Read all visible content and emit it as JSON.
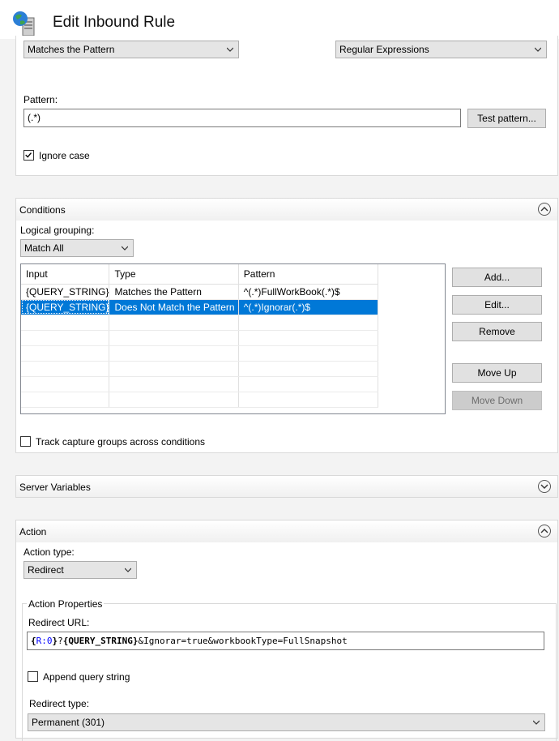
{
  "window": {
    "title": "Edit Inbound Rule",
    "icon": "globe-server-icon"
  },
  "match_url": {
    "requested_url": "Matches the Pattern",
    "using": "Regular Expressions",
    "pattern_label": "Pattern:",
    "pattern_value": "(.*)",
    "test_pattern_label": "Test pattern...",
    "ignore_case_label": "Ignore case",
    "ignore_case_checked": true
  },
  "conditions": {
    "header": "Conditions",
    "logical_grouping_label": "Logical grouping:",
    "logical_grouping_value": "Match All",
    "columns": [
      "Input",
      "Type",
      "Pattern"
    ],
    "rows": [
      {
        "input": "{QUERY_STRING}",
        "type": "Matches the Pattern",
        "pattern": "^(.*)FullWorkBook(.*)$"
      },
      {
        "input": "{QUERY_STRING}",
        "type": "Does Not Match the Pattern",
        "pattern": "^(.*)Ignorar(.*)$"
      }
    ],
    "selected_row": 1,
    "buttons": {
      "add": "Add...",
      "edit": "Edit...",
      "remove": "Remove",
      "move_up": "Move Up",
      "move_down": "Move Down"
    },
    "track_capture_label": "Track capture groups across conditions",
    "track_capture_checked": false
  },
  "server_variables": {
    "header": "Server Variables"
  },
  "action": {
    "header": "Action",
    "action_type_label": "Action type:",
    "action_type_value": "Redirect",
    "properties_label": "Action Properties",
    "redirect_url_label": "Redirect URL:",
    "redirect_url_parts": {
      "p1": "{",
      "p2": "R:0",
      "p3": "}",
      "p4": "?",
      "p5": "{",
      "p6": "QUERY_STRING",
      "p7": "}",
      "p8": "&Ignorar=true&workbookType=FullSnapshot"
    },
    "append_query_label": "Append query string",
    "append_query_checked": false,
    "redirect_type_label": "Redirect type:",
    "redirect_type_value": "Permanent (301)"
  },
  "colors": {
    "selection": "#0078d7",
    "token_blue": "#0000ff"
  }
}
